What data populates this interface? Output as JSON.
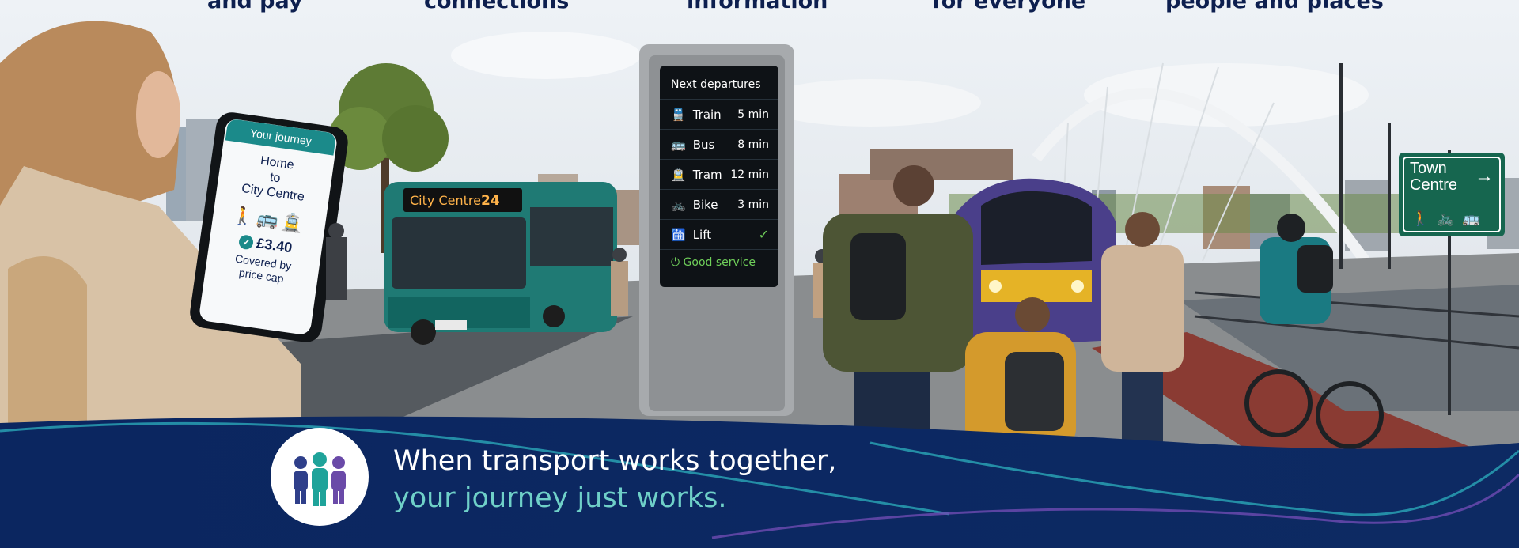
{
  "headlines": [
    "and pay",
    "connections",
    "information",
    "for everyone",
    "people and places"
  ],
  "phone": {
    "header": "Your journey",
    "from": "Home",
    "via": "to",
    "to": "City Centre",
    "mode_icons": [
      "walk-icon",
      "bus-icon",
      "tram-icon"
    ],
    "price": "£3.40",
    "note_line1": "Covered by",
    "note_line2": "price cap"
  },
  "bus": {
    "destination": "City Centre",
    "route_number": "24"
  },
  "departures": {
    "title": "Next departures",
    "rows": [
      {
        "mode": "Train",
        "time": "5 min",
        "icon": "train-icon"
      },
      {
        "mode": "Bus",
        "time": "8 min",
        "icon": "bus-icon"
      },
      {
        "mode": "Tram",
        "time": "12 min",
        "icon": "tram-icon"
      },
      {
        "mode": "Bike",
        "time": "3 min",
        "icon": "bike-icon"
      },
      {
        "mode": "Lift",
        "time": "✓",
        "icon": "lift-icon"
      }
    ],
    "status": "Good service"
  },
  "sign": {
    "line1": "Town",
    "line2": "Centre",
    "arrow": "→",
    "mode_icons": [
      "walk-icon",
      "bike-icon",
      "bus-icon"
    ]
  },
  "tagline": {
    "line1": "When transport works together,",
    "line2": "your journey just works."
  },
  "colors": {
    "navy": "#0d2a63",
    "teal": "#1b8a8a",
    "tagline_accent": "#6fd0c8",
    "status_green": "#6fcf5a",
    "bus_led": "#ffb34a"
  }
}
